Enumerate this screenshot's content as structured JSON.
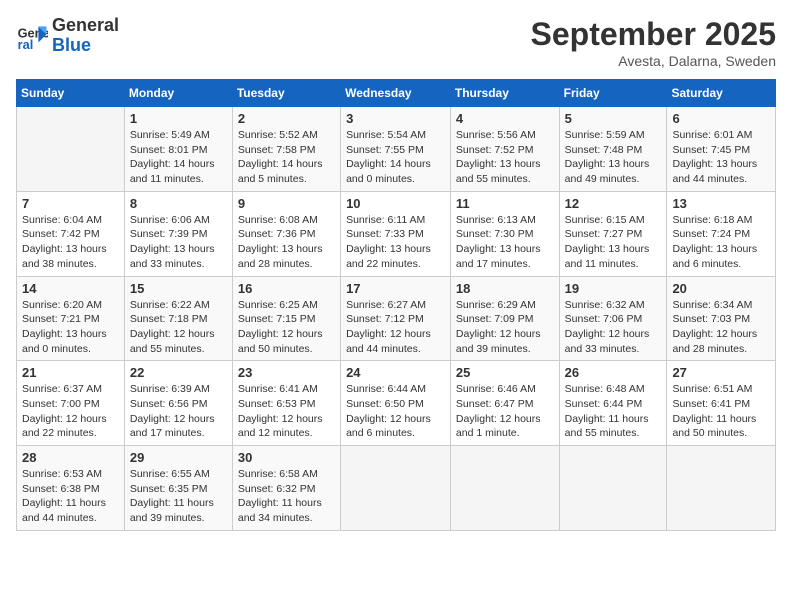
{
  "header": {
    "logo_line1": "General",
    "logo_line2": "Blue",
    "month": "September 2025",
    "location": "Avesta, Dalarna, Sweden"
  },
  "days_of_week": [
    "Sunday",
    "Monday",
    "Tuesday",
    "Wednesday",
    "Thursday",
    "Friday",
    "Saturday"
  ],
  "weeks": [
    [
      {
        "day": "",
        "info": ""
      },
      {
        "day": "1",
        "info": "Sunrise: 5:49 AM\nSunset: 8:01 PM\nDaylight: 14 hours\nand 11 minutes."
      },
      {
        "day": "2",
        "info": "Sunrise: 5:52 AM\nSunset: 7:58 PM\nDaylight: 14 hours\nand 5 minutes."
      },
      {
        "day": "3",
        "info": "Sunrise: 5:54 AM\nSunset: 7:55 PM\nDaylight: 14 hours\nand 0 minutes."
      },
      {
        "day": "4",
        "info": "Sunrise: 5:56 AM\nSunset: 7:52 PM\nDaylight: 13 hours\nand 55 minutes."
      },
      {
        "day": "5",
        "info": "Sunrise: 5:59 AM\nSunset: 7:48 PM\nDaylight: 13 hours\nand 49 minutes."
      },
      {
        "day": "6",
        "info": "Sunrise: 6:01 AM\nSunset: 7:45 PM\nDaylight: 13 hours\nand 44 minutes."
      }
    ],
    [
      {
        "day": "7",
        "info": "Sunrise: 6:04 AM\nSunset: 7:42 PM\nDaylight: 13 hours\nand 38 minutes."
      },
      {
        "day": "8",
        "info": "Sunrise: 6:06 AM\nSunset: 7:39 PM\nDaylight: 13 hours\nand 33 minutes."
      },
      {
        "day": "9",
        "info": "Sunrise: 6:08 AM\nSunset: 7:36 PM\nDaylight: 13 hours\nand 28 minutes."
      },
      {
        "day": "10",
        "info": "Sunrise: 6:11 AM\nSunset: 7:33 PM\nDaylight: 13 hours\nand 22 minutes."
      },
      {
        "day": "11",
        "info": "Sunrise: 6:13 AM\nSunset: 7:30 PM\nDaylight: 13 hours\nand 17 minutes."
      },
      {
        "day": "12",
        "info": "Sunrise: 6:15 AM\nSunset: 7:27 PM\nDaylight: 13 hours\nand 11 minutes."
      },
      {
        "day": "13",
        "info": "Sunrise: 6:18 AM\nSunset: 7:24 PM\nDaylight: 13 hours\nand 6 minutes."
      }
    ],
    [
      {
        "day": "14",
        "info": "Sunrise: 6:20 AM\nSunset: 7:21 PM\nDaylight: 13 hours\nand 0 minutes."
      },
      {
        "day": "15",
        "info": "Sunrise: 6:22 AM\nSunset: 7:18 PM\nDaylight: 12 hours\nand 55 minutes."
      },
      {
        "day": "16",
        "info": "Sunrise: 6:25 AM\nSunset: 7:15 PM\nDaylight: 12 hours\nand 50 minutes."
      },
      {
        "day": "17",
        "info": "Sunrise: 6:27 AM\nSunset: 7:12 PM\nDaylight: 12 hours\nand 44 minutes."
      },
      {
        "day": "18",
        "info": "Sunrise: 6:29 AM\nSunset: 7:09 PM\nDaylight: 12 hours\nand 39 minutes."
      },
      {
        "day": "19",
        "info": "Sunrise: 6:32 AM\nSunset: 7:06 PM\nDaylight: 12 hours\nand 33 minutes."
      },
      {
        "day": "20",
        "info": "Sunrise: 6:34 AM\nSunset: 7:03 PM\nDaylight: 12 hours\nand 28 minutes."
      }
    ],
    [
      {
        "day": "21",
        "info": "Sunrise: 6:37 AM\nSunset: 7:00 PM\nDaylight: 12 hours\nand 22 minutes."
      },
      {
        "day": "22",
        "info": "Sunrise: 6:39 AM\nSunset: 6:56 PM\nDaylight: 12 hours\nand 17 minutes."
      },
      {
        "day": "23",
        "info": "Sunrise: 6:41 AM\nSunset: 6:53 PM\nDaylight: 12 hours\nand 12 minutes."
      },
      {
        "day": "24",
        "info": "Sunrise: 6:44 AM\nSunset: 6:50 PM\nDaylight: 12 hours\nand 6 minutes."
      },
      {
        "day": "25",
        "info": "Sunrise: 6:46 AM\nSunset: 6:47 PM\nDaylight: 12 hours\nand 1 minute."
      },
      {
        "day": "26",
        "info": "Sunrise: 6:48 AM\nSunset: 6:44 PM\nDaylight: 11 hours\nand 55 minutes."
      },
      {
        "day": "27",
        "info": "Sunrise: 6:51 AM\nSunset: 6:41 PM\nDaylight: 11 hours\nand 50 minutes."
      }
    ],
    [
      {
        "day": "28",
        "info": "Sunrise: 6:53 AM\nSunset: 6:38 PM\nDaylight: 11 hours\nand 44 minutes."
      },
      {
        "day": "29",
        "info": "Sunrise: 6:55 AM\nSunset: 6:35 PM\nDaylight: 11 hours\nand 39 minutes."
      },
      {
        "day": "30",
        "info": "Sunrise: 6:58 AM\nSunset: 6:32 PM\nDaylight: 11 hours\nand 34 minutes."
      },
      {
        "day": "",
        "info": ""
      },
      {
        "day": "",
        "info": ""
      },
      {
        "day": "",
        "info": ""
      },
      {
        "day": "",
        "info": ""
      }
    ]
  ]
}
